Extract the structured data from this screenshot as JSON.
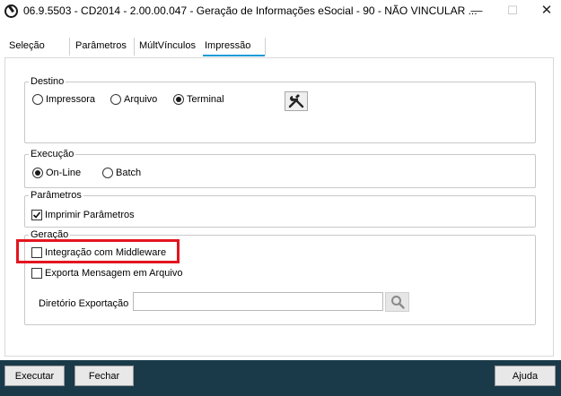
{
  "window": {
    "title": "06.9.5503 - CD2014 - 2.00.00.047 - Geração de Informações eSocial - 90 - NÃO VINCULAR ...",
    "minimize_glyph": "—",
    "maximize_glyph": "☐",
    "close_glyph": "✕"
  },
  "tabs": [
    {
      "label": "Seleção"
    },
    {
      "label": "Parâmetros"
    },
    {
      "label": "MúltVínculos"
    },
    {
      "label": "Impressão",
      "active": true
    }
  ],
  "destino": {
    "legend": "Destino",
    "options": [
      "Impressora",
      "Arquivo",
      "Terminal"
    ],
    "selected": "Terminal"
  },
  "execucao": {
    "legend": "Execução",
    "options": [
      "On-Line",
      "Batch"
    ],
    "selected": "On-Line"
  },
  "parametros": {
    "legend": "Parâmetros",
    "imprimir_label": "Imprimir Parâmetros",
    "imprimir_checked": true
  },
  "geracao": {
    "legend": "Geração",
    "middleware_label": "Integração com Middleware",
    "middleware_checked": false,
    "exporta_label": "Exporta Mensagem em Arquivo",
    "exporta_checked": false,
    "diretorio_label": "Diretório Exportação",
    "diretorio_value": ""
  },
  "footer": {
    "executar": "Executar",
    "fechar": "Fechar",
    "ajuda": "Ajuda"
  },
  "colors": {
    "footer_bg": "#1a3a4a",
    "tab_active": "#1a9bd7",
    "highlight": "#e3151f"
  }
}
